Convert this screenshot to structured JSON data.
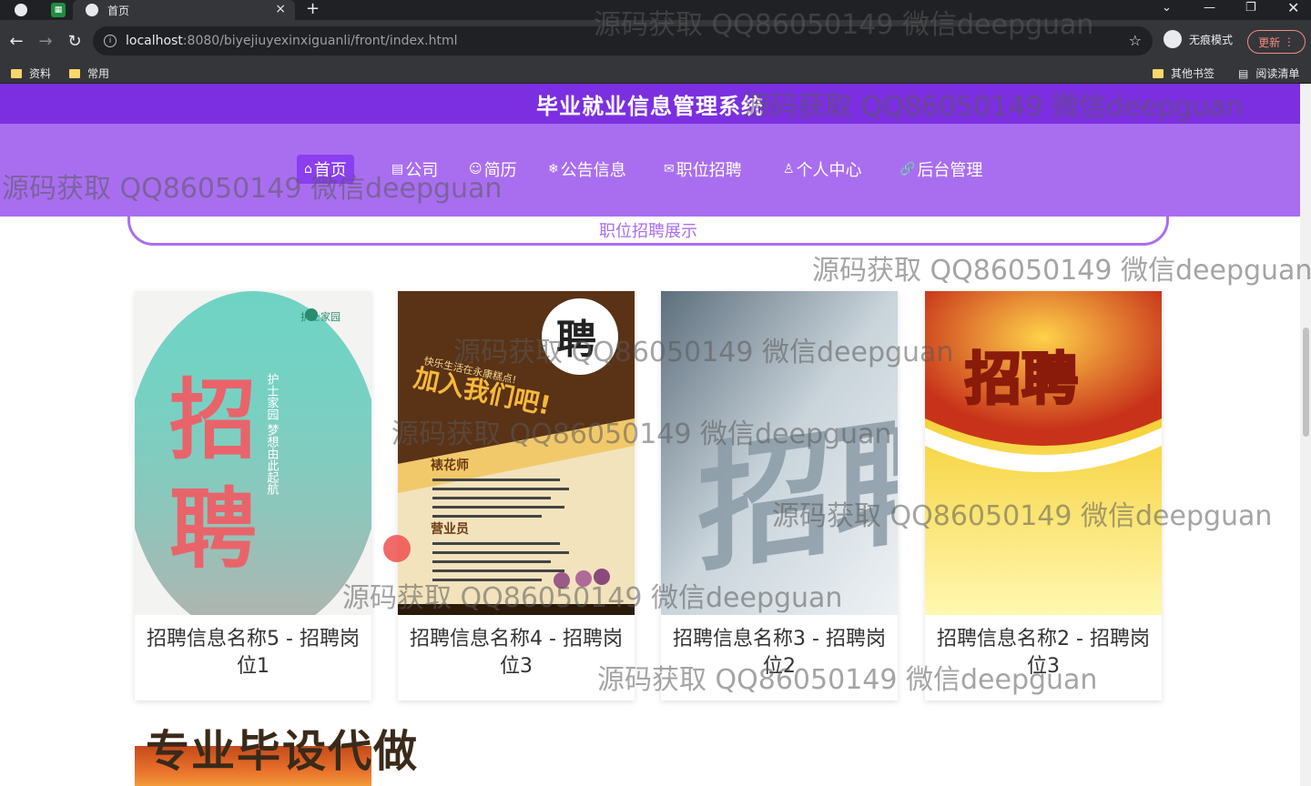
{
  "browser": {
    "tab_title": "首页",
    "url_host": "localhost",
    "url_path": ":8080/biyejiuyexinxiguanli/front/index.html",
    "incognito_label": "无痕模式",
    "update_label": "更新",
    "bookmarks": [
      "资料",
      "常用"
    ],
    "bookmarks_right": [
      "其他书签",
      "阅读清单"
    ]
  },
  "site": {
    "title": "毕业就业信息管理系统"
  },
  "nav": {
    "items": [
      {
        "icon": "⌂",
        "label": "首页"
      },
      {
        "icon": "▤",
        "label": "公司"
      },
      {
        "icon": "☺",
        "label": "简历"
      },
      {
        "icon": "❄",
        "label": "公告信息"
      },
      {
        "icon": "✉",
        "label": "职位招聘"
      },
      {
        "icon": "♙",
        "label": "个人中心"
      },
      {
        "icon": "🔗",
        "label": "后台管理"
      }
    ]
  },
  "section": {
    "title": "职位招聘展示"
  },
  "cards": [
    {
      "caption": "招聘信息名称5 - 招聘岗位1"
    },
    {
      "caption": "招聘信息名称4 - 招聘岗位3"
    },
    {
      "caption": "招聘信息名称3 - 招聘岗位2"
    },
    {
      "caption": "招聘信息名称2 - 招聘岗位3"
    }
  ],
  "poster_text": {
    "card1_big": "招聘",
    "card1_brand": "护士家园",
    "card1_vertical": "护士家园 梦想由此起航",
    "card2_bubble": "聘",
    "card2_slogan_small": "快乐生活在永康糕点!",
    "card2_slogan": "加入我们吧!",
    "card2_job1": "裱花师",
    "card2_job2": "营业员",
    "card3_big": "招聘",
    "card4_big": "招聘"
  },
  "promo": {
    "title": "专业毕设代做"
  },
  "watermark": "源码获取 QQ86050149 微信deepguan"
}
